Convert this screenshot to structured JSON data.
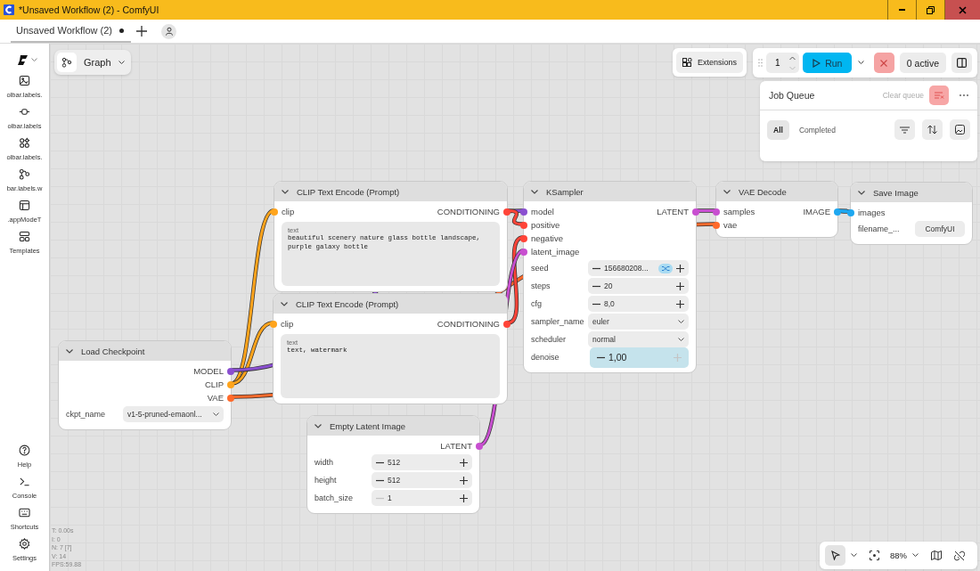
{
  "window": {
    "title": "*Unsaved Workflow (2) - ComfyUI"
  },
  "tabs": [
    {
      "label": "Unsaved Workflow (2)",
      "selected": true,
      "modified": true
    }
  ],
  "sidebar": {
    "items": [
      {
        "kind": "images",
        "label": "olbar.labels."
      },
      {
        "kind": "nodes",
        "label": "olbar.labels"
      },
      {
        "kind": "models",
        "label": "olbar.labels."
      },
      {
        "kind": "workflows",
        "label": "bar.labels.w"
      },
      {
        "kind": "layout",
        "label": ".appModeT"
      },
      {
        "kind": "templates",
        "label": "Templates"
      }
    ],
    "bottom_items": [
      {
        "kind": "help",
        "label": "Help"
      },
      {
        "kind": "console",
        "label": "Console"
      },
      {
        "kind": "shortcuts",
        "label": "Shortcuts"
      },
      {
        "kind": "settings",
        "label": "Settings"
      }
    ]
  },
  "graph_menu": {
    "label": "Graph"
  },
  "toolbar": {
    "extensions": "Extensions",
    "batch_count": "1",
    "run": "Run",
    "active": "0 active"
  },
  "job_queue": {
    "title": "Job Queue",
    "clear": "Clear queue",
    "filters": [
      {
        "label": "All",
        "selected": true
      },
      {
        "label": "Completed",
        "selected": false
      }
    ]
  },
  "nodes": [
    {
      "title": "CLIP Text Encode (Prompt)",
      "inputs": [
        {
          "name": "clip",
          "color": "#ffa41c"
        }
      ],
      "outputs": [
        {
          "name": "CONDITIONING",
          "color": "#ff4438"
        }
      ],
      "widgets": [
        {
          "kind": "text",
          "label": "text",
          "value": "beautiful scenery nature glass bottle landscape, purple galaxy bottle"
        }
      ]
    },
    {
      "title": "KSampler",
      "inputs": [
        {
          "name": "model",
          "color": "#8a4fd0"
        },
        {
          "name": "positive",
          "color": "#ff4438"
        },
        {
          "name": "negative",
          "color": "#ff4438"
        },
        {
          "name": "latent_image",
          "color": "#c84fd0"
        }
      ],
      "outputs": [
        {
          "name": "LATENT",
          "color": "#c84fd0"
        }
      ],
      "widgets": [
        {
          "kind": "number",
          "label": "seed",
          "value": "156680208...",
          "randomize": true
        },
        {
          "kind": "number",
          "label": "steps",
          "value": "20"
        },
        {
          "kind": "number",
          "label": "cfg",
          "value": "8,0"
        },
        {
          "kind": "combo",
          "label": "sampler_name",
          "value": "euler"
        },
        {
          "kind": "combo",
          "label": "scheduler",
          "value": "normal"
        },
        {
          "kind": "number",
          "label": "denoise",
          "value": "1,00",
          "active": true,
          "inc_disabled": true
        }
      ]
    },
    {
      "title": "VAE Decode",
      "inputs": [
        {
          "name": "samples",
          "color": "#c84fd0"
        },
        {
          "name": "vae",
          "color": "#ff6a2b"
        }
      ],
      "outputs": [
        {
          "name": "IMAGE",
          "color": "#1ea7f0"
        }
      ]
    },
    {
      "title": "Save Image",
      "inputs": [
        {
          "name": "images",
          "color": "#1ea7f0"
        }
      ],
      "widgets": [
        {
          "kind": "string",
          "label": "filename_...",
          "value": "ComfyUI"
        }
      ]
    },
    {
      "title": "CLIP Text Encode (Prompt)",
      "inputs": [
        {
          "name": "clip",
          "color": "#ffa41c"
        }
      ],
      "outputs": [
        {
          "name": "CONDITIONING",
          "color": "#ff4438"
        }
      ],
      "widgets": [
        {
          "kind": "text",
          "label": "text",
          "value": "text, watermark"
        }
      ]
    },
    {
      "title": "Load Checkpoint",
      "outputs": [
        {
          "name": "MODEL",
          "color": "#8a4fd0"
        },
        {
          "name": "CLIP",
          "color": "#ffa41c"
        },
        {
          "name": "VAE",
          "color": "#ff6a2b"
        }
      ],
      "widgets": [
        {
          "kind": "combo",
          "label": "ckpt_name",
          "value": "v1-5-pruned-emaonl..."
        }
      ]
    },
    {
      "title": "Empty Latent Image",
      "outputs": [
        {
          "name": "LATENT",
          "color": "#c84fd0"
        }
      ],
      "widgets": [
        {
          "kind": "number",
          "label": "width",
          "value": "512"
        },
        {
          "kind": "number",
          "label": "height",
          "value": "512"
        },
        {
          "kind": "number",
          "label": "batch_size",
          "value": "1",
          "dec_disabled": true
        }
      ]
    }
  ],
  "stats": [
    "T: 0.00s",
    "I: 0",
    "N: 7 [7]",
    "V: 14",
    "FPS:59.88"
  ],
  "canvas_controls": {
    "select_active": true,
    "zoom": "88%"
  }
}
